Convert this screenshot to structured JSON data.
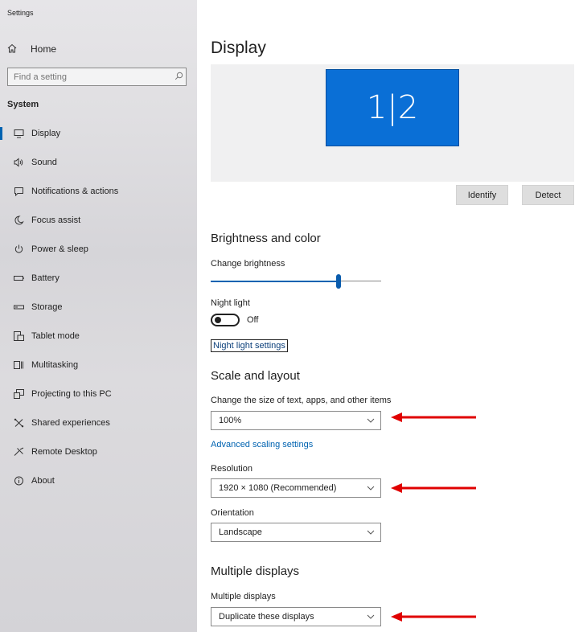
{
  "window": {
    "title": "Settings"
  },
  "sidebar": {
    "home_label": "Home",
    "search_placeholder": "Find a setting",
    "section_label": "System",
    "items": [
      {
        "label": "Display",
        "icon": "monitor-icon",
        "active": true
      },
      {
        "label": "Sound",
        "icon": "speaker-icon"
      },
      {
        "label": "Notifications & actions",
        "icon": "notification-icon"
      },
      {
        "label": "Focus assist",
        "icon": "moon-icon"
      },
      {
        "label": "Power & sleep",
        "icon": "power-icon"
      },
      {
        "label": "Battery",
        "icon": "battery-icon"
      },
      {
        "label": "Storage",
        "icon": "storage-icon"
      },
      {
        "label": "Tablet mode",
        "icon": "tablet-icon"
      },
      {
        "label": "Multitasking",
        "icon": "multitasking-icon"
      },
      {
        "label": "Projecting to this PC",
        "icon": "projecting-icon"
      },
      {
        "label": "Shared experiences",
        "icon": "shared-icon"
      },
      {
        "label": "Remote Desktop",
        "icon": "remote-desktop-icon"
      },
      {
        "label": "About",
        "icon": "info-icon"
      }
    ]
  },
  "main": {
    "title": "Display",
    "monitor_label": "1|2",
    "identify_label": "Identify",
    "detect_label": "Detect",
    "brightness": {
      "heading": "Brightness and color",
      "change_label": "Change brightness",
      "level": 0.75,
      "night_light_label": "Night light",
      "night_light_state": "Off",
      "night_light_link": "Night light settings"
    },
    "scale": {
      "heading": "Scale and layout",
      "size_label": "Change the size of text, apps, and other items",
      "size_value": "100%",
      "advanced_link": "Advanced scaling settings",
      "resolution_label": "Resolution",
      "resolution_value": "1920 × 1080 (Recommended)",
      "orientation_label": "Orientation",
      "orientation_value": "Landscape"
    },
    "multiple": {
      "heading": "Multiple displays",
      "label": "Multiple displays",
      "value": "Duplicate these displays"
    }
  },
  "colors": {
    "accent": "#0063b1",
    "tile": "#0a6fd6",
    "arrow": "#e00000"
  }
}
